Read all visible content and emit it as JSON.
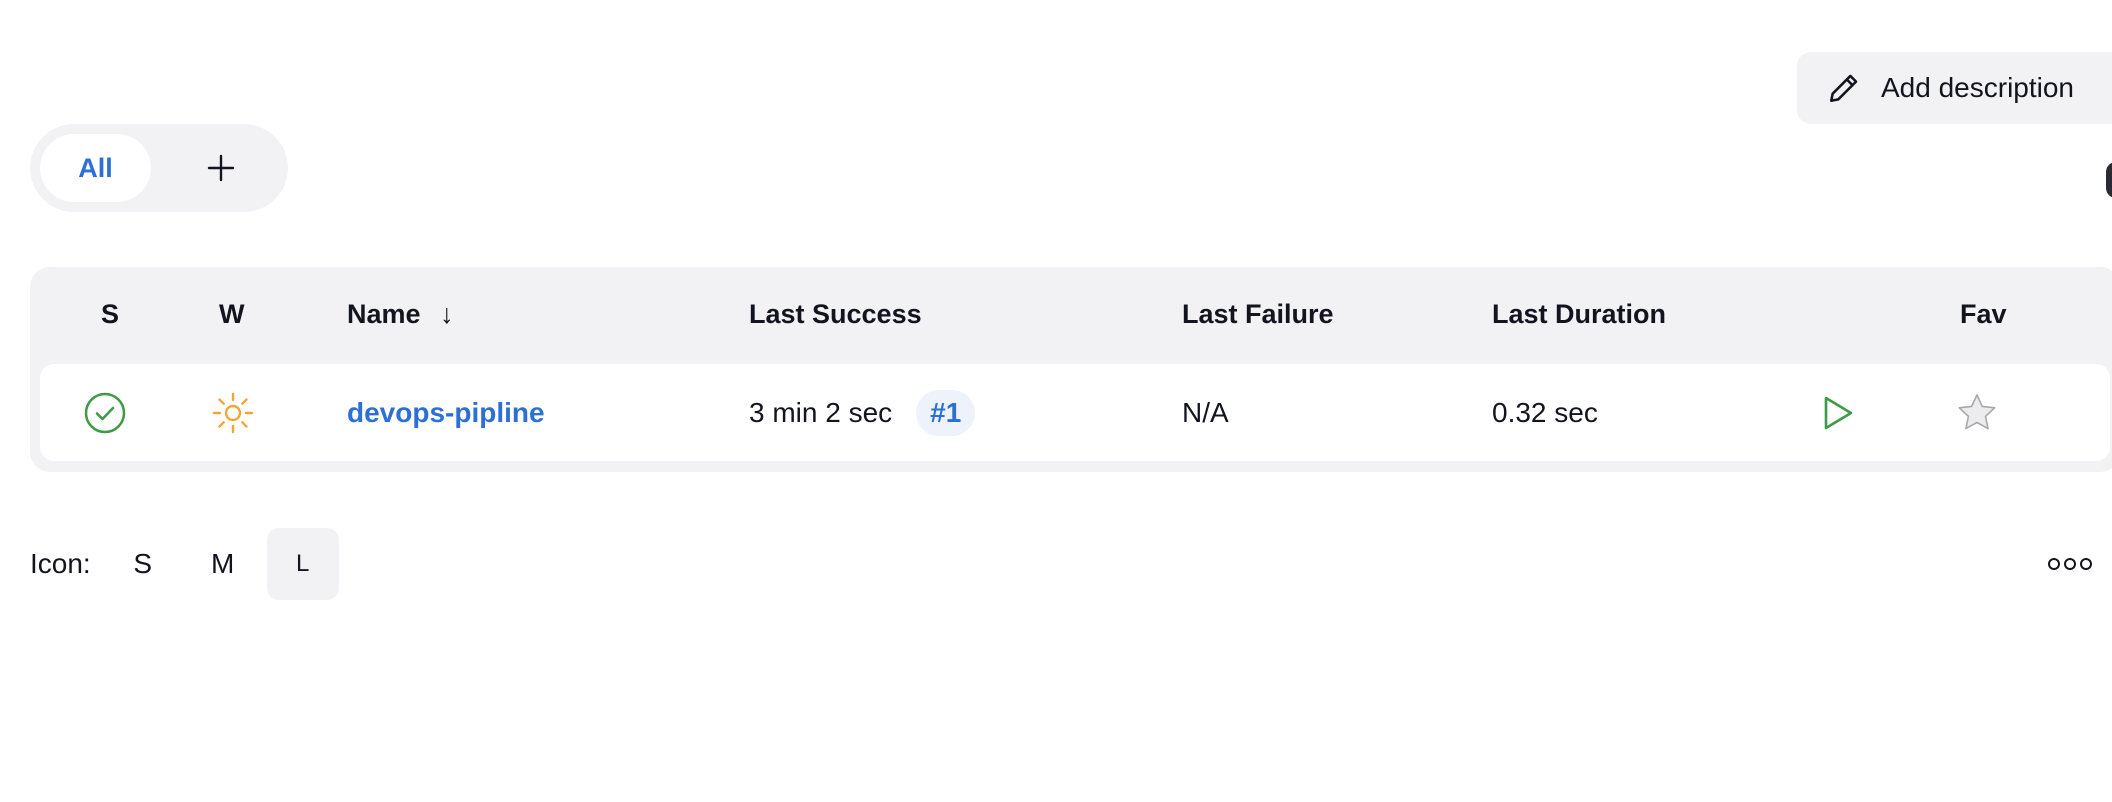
{
  "header": {
    "add_description_label": "Add description",
    "pencil_icon": "pencil-icon"
  },
  "tabs": {
    "items": [
      {
        "label": "All",
        "active": true
      }
    ],
    "add_icon": "plus-icon"
  },
  "table": {
    "columns": {
      "status": "S",
      "weather": "W",
      "name": "Name",
      "name_sort": "↓",
      "last_success": "Last Success",
      "last_failure": "Last Failure",
      "last_duration": "Last Duration",
      "fav": "Fav"
    },
    "rows": [
      {
        "status_icon": "success-check-icon",
        "weather_icon": "sunny-icon",
        "name": "devops-pipline",
        "last_success": "3 min 2 sec",
        "last_success_build": "#1",
        "last_failure": "N/A",
        "last_duration": "0.32 sec",
        "run_icon": "play-icon",
        "fav_icon": "star-icon"
      }
    ]
  },
  "icon_size": {
    "label": "Icon:",
    "options": [
      "S",
      "M",
      "L"
    ],
    "selected": "L"
  },
  "colors": {
    "accent": "#2c6fd6",
    "success": "#3d9b45",
    "weather": "#f2a735",
    "surface": "#f2f2f5"
  }
}
